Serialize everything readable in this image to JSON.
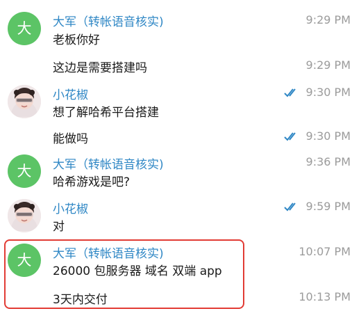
{
  "messages": [
    {
      "sender": "大军（转帐语音核实)",
      "avatar_initial": "大",
      "text": "老板你好",
      "time": "9:29 PM"
    },
    {
      "text": "这边是需要搭建吗",
      "time": "9:29 PM"
    },
    {
      "sender": "小花椒",
      "avatar": "photo-avatar",
      "text": "想了解哈希平台搭建",
      "time": "9:30 PM",
      "status_icon": "double-check-icon"
    },
    {
      "text": "能做吗",
      "time": "9:30 PM",
      "status_icon": "double-check-icon"
    },
    {
      "sender": "大军（转帐语音核实)",
      "avatar_initial": "大",
      "text": "哈希游戏是吧?",
      "time": "9:36 PM"
    },
    {
      "sender": "小花椒",
      "avatar": "photo-avatar",
      "text": "对",
      "time": "9:59 PM",
      "status_icon": "double-check-icon"
    },
    {
      "sender": "大军（转帐语音核实)",
      "avatar_initial": "大",
      "text": "26000 包服务器 域名 双端 app",
      "time": "10:07 PM"
    },
    {
      "text": "3天内交付",
      "time": "10:13 PM"
    }
  ],
  "colors": {
    "sender_name": "#2f87c5",
    "avatar_green": "#5cc466",
    "read_check": "#2f87c5",
    "timestamp": "#9b9b9b",
    "highlight_box": "#e23b34"
  }
}
